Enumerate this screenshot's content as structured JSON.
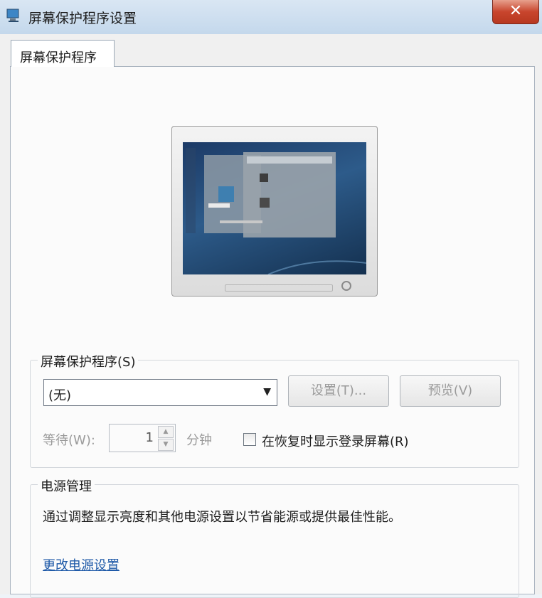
{
  "window": {
    "title": "屏幕保护程序设置",
    "close_symbol": "✕"
  },
  "tabs": [
    {
      "label": "屏幕保护程序"
    }
  ],
  "screensaver": {
    "group_label": "屏幕保护程序(S)",
    "selected": "(无)",
    "settings_button": "设置(T)...",
    "preview_button": "预览(V)",
    "wait_label": "等待(W):",
    "wait_value": "1",
    "wait_unit": "分钟",
    "resume_checkbox_label": "在恢复时显示登录屏幕(R)",
    "resume_checked": false
  },
  "power": {
    "group_label": "电源管理",
    "description": "通过调整显示亮度和其他电源设置以节省能源或提供最佳性能。",
    "link": "更改电源设置"
  },
  "colors": {
    "link": "#1f5aa8",
    "close": "#c8452d",
    "disabled_text": "#9b9b9b"
  }
}
